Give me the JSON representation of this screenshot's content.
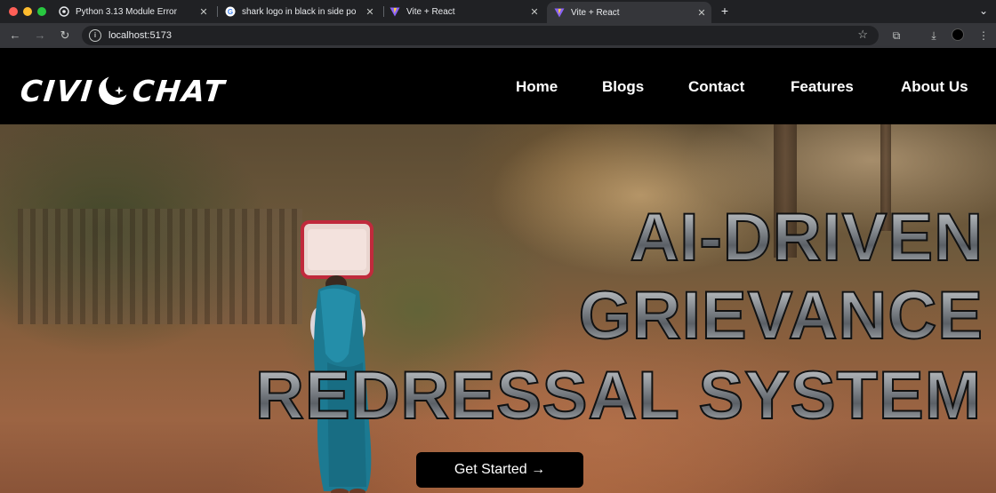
{
  "browser": {
    "tabs": [
      {
        "title": "Python 3.13 Module Error",
        "favicon": "chatgpt-icon",
        "active": false
      },
      {
        "title": "shark logo in black in side po",
        "favicon": "google-icon",
        "active": false
      },
      {
        "title": "Vite + React",
        "favicon": "vite-icon",
        "active": false
      },
      {
        "title": "Vite + React",
        "favicon": "vite-icon",
        "active": true
      }
    ],
    "url": "localhost:5173"
  },
  "site": {
    "logo_left": "CIVI",
    "logo_right": "CHAT",
    "nav": [
      "Home",
      "Blogs",
      "Contact",
      "Features",
      "About Us"
    ]
  },
  "hero": {
    "headline_lines": [
      "AI-DRIVEN",
      "GRIEVANCE",
      "REDRESSAL SYSTEM"
    ],
    "cta_label": "Get Started →"
  }
}
